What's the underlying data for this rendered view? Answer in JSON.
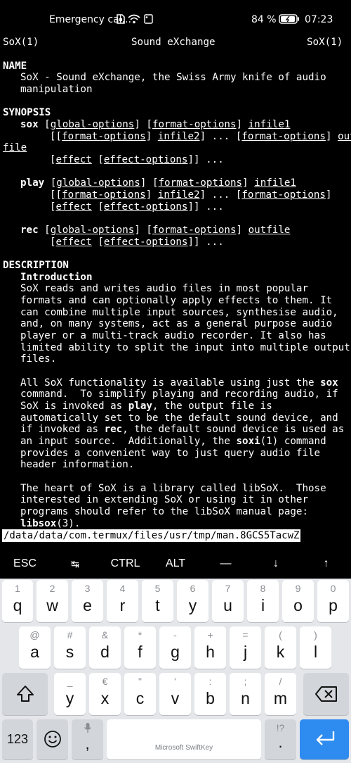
{
  "status_bar": {
    "carrier": "Emergency cal...",
    "battery": "84 %",
    "time": "07:23",
    "icons": [
      "sim-icon",
      "wifi-icon",
      "notification-icon",
      "battery-icon"
    ]
  },
  "terminal": {
    "header": {
      "left": "SoX(1)",
      "center": "Sound eXchange",
      "right": "SoX(1)"
    },
    "name_heading": "NAME",
    "name_line1": "SoX - Sound eXchange, the Swiss Army knife of audio",
    "name_line2": "manipulation",
    "synopsis_heading": "SYNOPSIS",
    "sox_cmd": "sox",
    "play_cmd": "play",
    "rec_cmd": "rec",
    "global_options": "global-options",
    "format_options": "format-options",
    "infile1": "infile1",
    "infile2": "infile2",
    "outfile": "outfile",
    "out": "out",
    "file": "file",
    "effect": "effect",
    "effect_options": "effect-options",
    "description_heading": "DESCRIPTION",
    "intro_heading": "Introduction",
    "para1": [
      "SoX reads and writes audio files in most popular",
      "formats and can optionally apply effects to them. It",
      "can combine multiple input sources, synthesise audio,",
      "and, on many systems, act as a general purpose audio",
      "player or a multi-track audio recorder. It also has",
      "limited ability to split the input into multiple output",
      "files."
    ],
    "para2_l1a": "All SoX functionality is available using just the ",
    "para2_l2b": "  To simplify playing and recording audio, if",
    "para2_l3a": "SoX is invoked as ",
    "para2_l3b": ", the output file is",
    "para2_l4": "automatically set to be the default sound device, and",
    "para2_l5a": "if invoked as ",
    "para2_l5b": ", the default sound device is used as",
    "para2_l6a": "an input source.  Additionally, the ",
    "para2_l6b": "(1) command",
    "para2_l7": "provides a convenient way to just query audio file",
    "para2_l8": "header information.",
    "command_word": "command.",
    "soxi": "soxi",
    "para3_l1": "The heart of SoX is a library called libSoX.  Those",
    "para3_l2": "interested in extending SoX or using it in other",
    "para3_l3": "programs should refer to the libSoX manual page:",
    "libsox": "libsox",
    "libsox_suffix": "(3).",
    "pager_path": "/data/data/com.termux/files/usr/tmp/man.8GCS5TacwZ"
  },
  "extra_keys": [
    "ESC",
    "↹",
    "CTRL",
    "ALT",
    "—",
    "↓",
    "↑"
  ],
  "keyboard": {
    "row1": [
      {
        "h": "1",
        "k": "q"
      },
      {
        "h": "2",
        "k": "w"
      },
      {
        "h": "3",
        "k": "e"
      },
      {
        "h": "4",
        "k": "r"
      },
      {
        "h": "5",
        "k": "t"
      },
      {
        "h": "6",
        "k": "y"
      },
      {
        "h": "7",
        "k": "u"
      },
      {
        "h": "8",
        "k": "i"
      },
      {
        "h": "9",
        "k": "o"
      },
      {
        "h": "0",
        "k": "p"
      }
    ],
    "row2": [
      {
        "h": "@",
        "k": "a"
      },
      {
        "h": "#",
        "k": "s"
      },
      {
        "h": "&",
        "k": "d"
      },
      {
        "h": "*",
        "k": "f"
      },
      {
        "h": "-",
        "k": "g"
      },
      {
        "h": "+",
        "k": "h"
      },
      {
        "h": "=",
        "k": "j"
      },
      {
        "h": "(",
        "k": "k"
      },
      {
        "h": ")",
        "k": "l"
      }
    ],
    "row3": [
      {
        "h": "_",
        "k": "y"
      },
      {
        "h": "€",
        "k": "x"
      },
      {
        "h": "\"",
        "k": "c"
      },
      {
        "h": "'",
        "k": "v"
      },
      {
        "h": ":",
        "k": "b"
      },
      {
        "h": ";",
        "k": "n"
      },
      {
        "h": "/",
        "k": "m"
      }
    ],
    "numbers_label": "123",
    "punct_hint": "!?",
    "punct_key": ",",
    "period_key": ".",
    "comma_key": ",",
    "space_label": "Microsoft SwiftKey"
  }
}
